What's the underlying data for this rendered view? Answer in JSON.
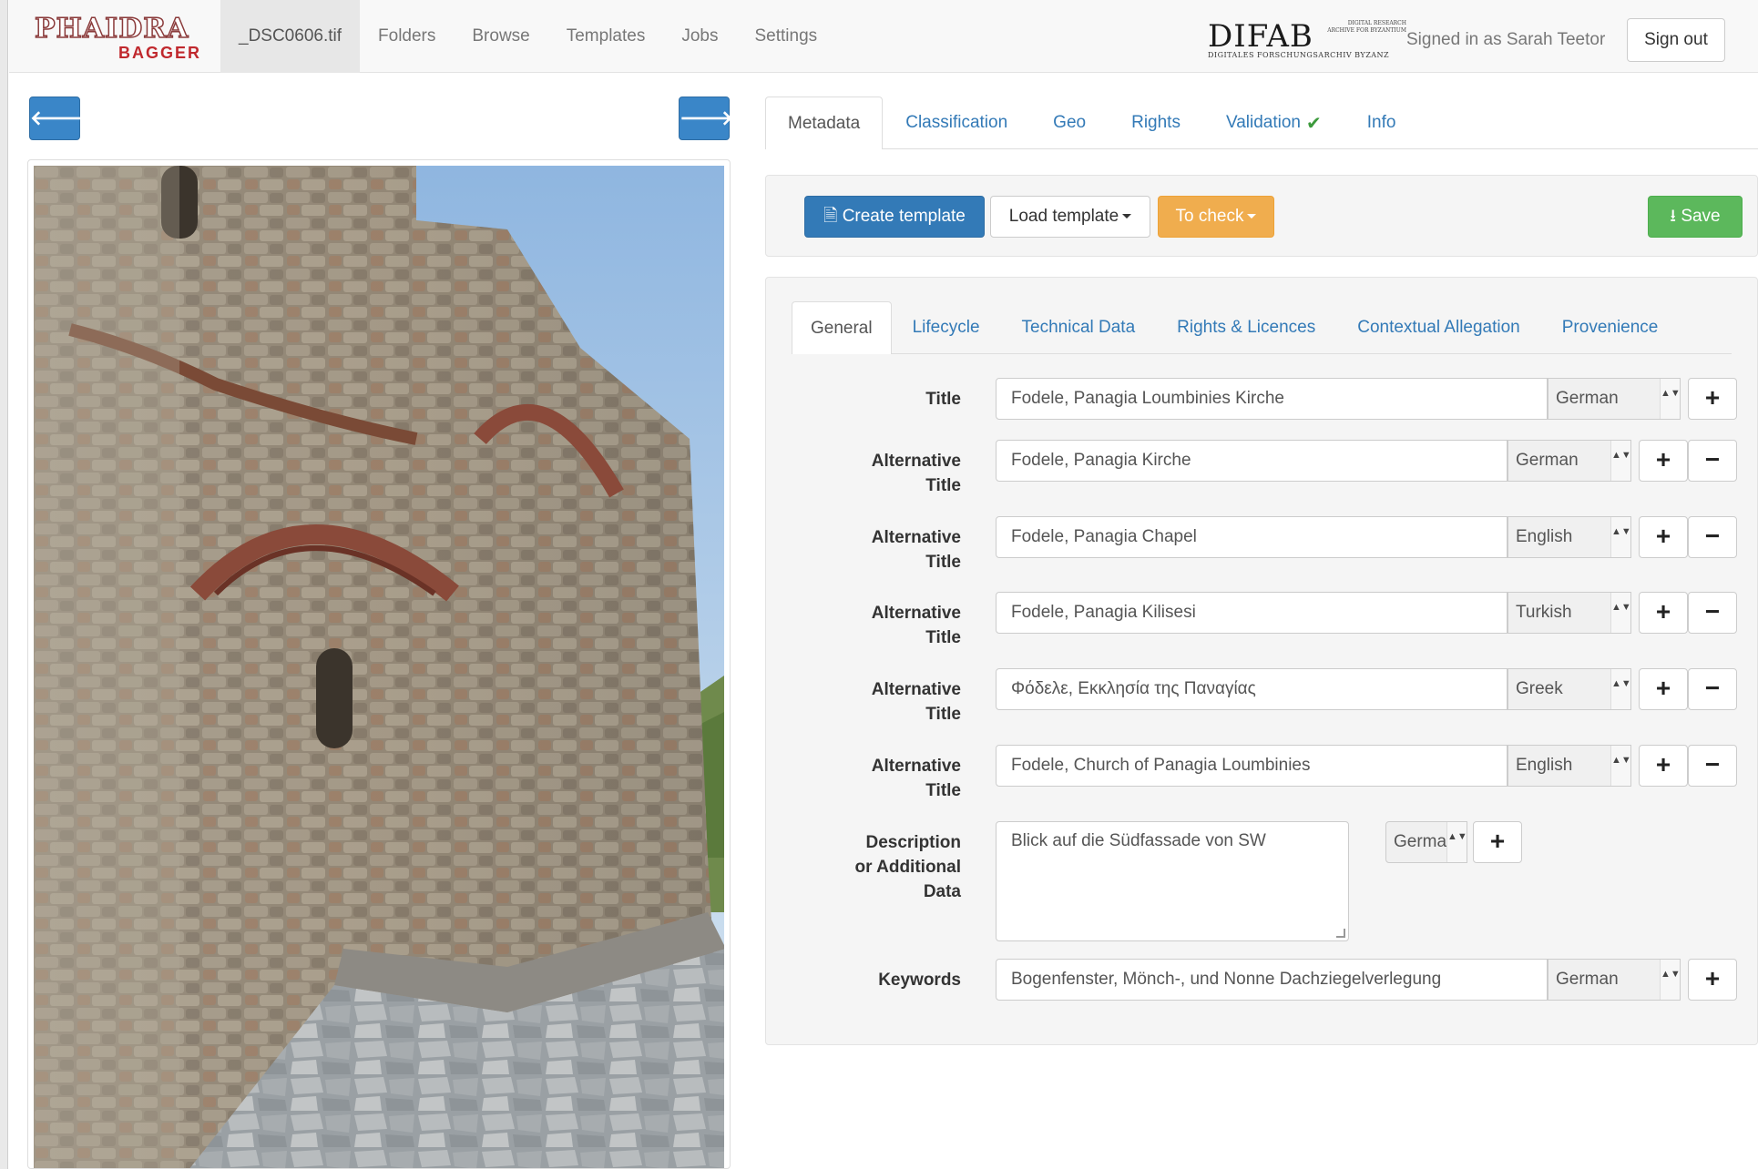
{
  "navbar": {
    "logo_top": "PHAIDRA",
    "logo_bottom": "BAGGER",
    "items": [
      {
        "label": "_DSC0606.tif",
        "active": true
      },
      {
        "label": "Folders"
      },
      {
        "label": "Browse"
      },
      {
        "label": "Templates"
      },
      {
        "label": "Jobs"
      },
      {
        "label": "Settings"
      }
    ],
    "partner_logo": "DIFAB",
    "partner_tagline": "DIGITALES FORSCHUNGSARCHIV BYZANZ",
    "partner_side": "DIGITAL RESEARCH ARCHIVE FOR BYZANTIUM",
    "signed_in": "Signed in as Sarah Teetor",
    "sign_out": "Sign out"
  },
  "viewer": {
    "prev_icon": "arrow-left-icon",
    "next_icon": "arrow-right-icon",
    "prev_glyph": "🡐",
    "next_glyph": "🡒"
  },
  "top_tabs": [
    {
      "label": "Metadata",
      "active": true
    },
    {
      "label": "Classification"
    },
    {
      "label": "Geo"
    },
    {
      "label": "Rights"
    },
    {
      "label": "Validation"
    },
    {
      "label": "Info"
    }
  ],
  "validation_check": "✔",
  "toolbar": {
    "create_template": "Create template",
    "load_template": "Load template",
    "to_check": "To check",
    "save": "Save",
    "file_glyph": "🗎",
    "download_glyph": "⭳"
  },
  "sub_tabs": [
    {
      "label": "General",
      "active": true
    },
    {
      "label": "Lifecycle"
    },
    {
      "label": "Technical Data"
    },
    {
      "label": "Rights & Licences"
    },
    {
      "label": "Contextual Allegation"
    },
    {
      "label": "Provenience"
    }
  ],
  "form": {
    "title": {
      "label": "Title",
      "value": "Fodele, Panagia Loumbinies Kirche",
      "lang": "German"
    },
    "alt_label_1": "Alternative",
    "alt_label_2": "Title",
    "alt_titles": [
      {
        "value": "Fodele, Panagia Kirche",
        "lang": "German"
      },
      {
        "value": "Fodele, Panagia Chapel",
        "lang": "English"
      },
      {
        "value": "Fodele, Panagia Kilisesi",
        "lang": "Turkish"
      },
      {
        "value": "Φόδελε, Εκκλησία της Παναγίας",
        "lang": "Greek"
      },
      {
        "value": "Fodele, Church of Panagia Loumbinies",
        "lang": "English"
      }
    ],
    "description": {
      "label_1": "Description",
      "label_2": "or Additional",
      "label_3": "Data",
      "value": "Blick auf die Südfassade von SW",
      "lang": "German"
    },
    "keywords": {
      "label": "Keywords",
      "value": "Bogenfenster, Mönch-, und Nonne Dachziegelverlegung",
      "lang": "German"
    },
    "plus": "+",
    "minus": "−",
    "updown": "▲▼"
  }
}
